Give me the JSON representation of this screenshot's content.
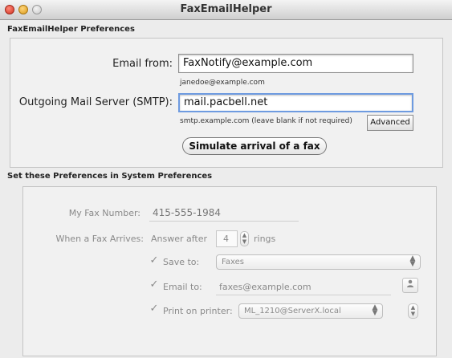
{
  "window": {
    "title": "FaxEmailHelper"
  },
  "prefs": {
    "section_title": "FaxEmailHelper Preferences",
    "email_from_label": "Email from:",
    "email_from_value": "FaxNotify@example.com",
    "email_from_hint": "janedoe@example.com",
    "smtp_label": "Outgoing Mail Server (SMTP):",
    "smtp_value": "mail.pacbell.net",
    "smtp_hint": "smtp.example.com  (leave blank if not required)",
    "advanced_label": "Advanced",
    "simulate_label": "Simulate arrival of a fax"
  },
  "system": {
    "section_title": "Set these Preferences in System Preferences",
    "fax_number_label": "My Fax Number:",
    "fax_number_value": "415-555-1984",
    "arrives_label": "When a Fax Arrives:",
    "answer_after_label": "Answer after",
    "rings_value": "4",
    "rings_label": "rings",
    "save_to_label": "Save to:",
    "save_to_value": "Faxes",
    "email_to_label": "Email to:",
    "email_to_value": "faxes@example.com",
    "print_label": "Print on printer:",
    "print_value": "ML_1210@ServerX.local"
  },
  "icons": {
    "checkmark": "✓",
    "popup_arrows": "▲▼",
    "address_book": "person-icon"
  }
}
